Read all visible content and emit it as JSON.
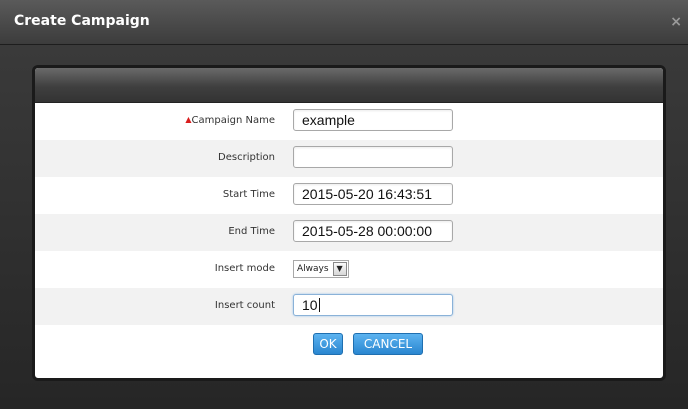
{
  "dialog": {
    "title": "Create Campaign",
    "close_glyph": "×"
  },
  "form": {
    "required_marker": "▲",
    "fields": {
      "campaign_name": {
        "label": "Campaign Name",
        "value": "example",
        "required": true
      },
      "description": {
        "label": "Description",
        "value": ""
      },
      "start_time": {
        "label": "Start Time",
        "value": "2015-05-20 16:43:51"
      },
      "end_time": {
        "label": "End Time",
        "value": "2015-05-28 00:00:00"
      },
      "insert_mode": {
        "label": "Insert mode",
        "value": "Always",
        "dropdown_glyph": "▼"
      },
      "insert_count": {
        "label": "Insert count",
        "value": "10"
      }
    }
  },
  "buttons": {
    "ok": "OK",
    "cancel": "CANCEL"
  },
  "colors": {
    "accent": "#2a86d0",
    "required": "#d91c1c",
    "titlebar": "#4a4a4a"
  },
  "icons": {
    "close": "close-icon",
    "dropdown": "chevron-down-icon",
    "required": "required-marker-icon"
  }
}
